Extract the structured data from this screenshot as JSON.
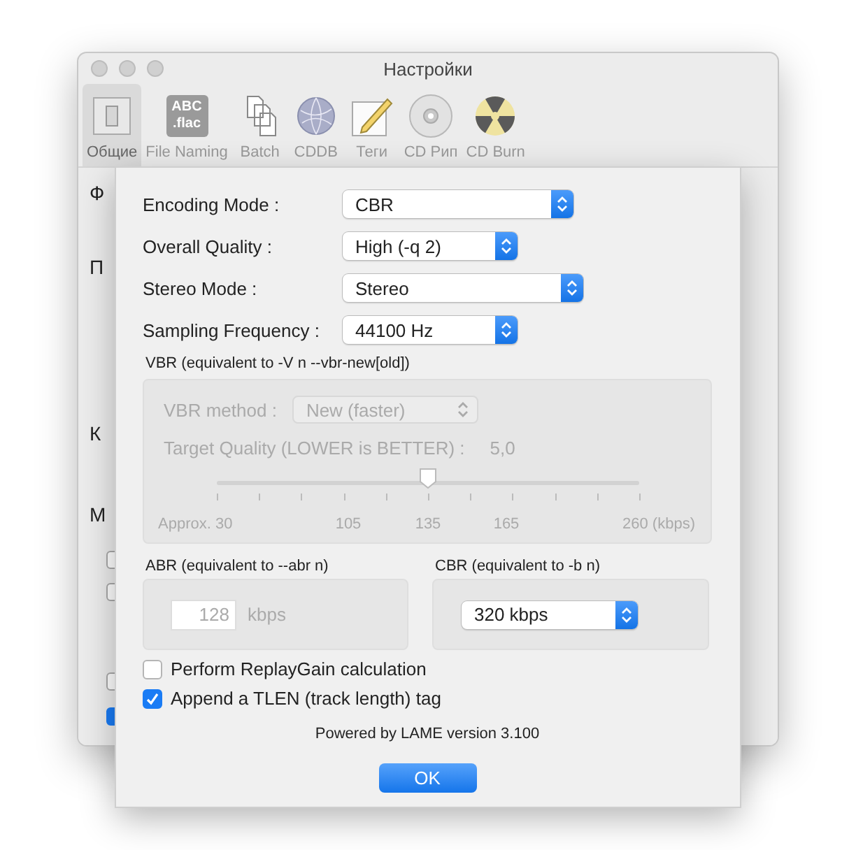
{
  "window": {
    "title": "Настройки"
  },
  "tabs": [
    {
      "label": "Общие",
      "kind": "general",
      "selected": true
    },
    {
      "label": "File Naming",
      "kind": "abc",
      "icon_text": [
        "ABC",
        ".flac"
      ],
      "selected": false
    },
    {
      "label": "Batch",
      "kind": "pages",
      "selected": false
    },
    {
      "label": "CDDB",
      "kind": "globe",
      "selected": false
    },
    {
      "label": "Теги",
      "kind": "note",
      "selected": false
    },
    {
      "label": "CD Рип",
      "kind": "disc",
      "selected": false
    },
    {
      "label": "CD Burn",
      "kind": "burn",
      "selected": false
    }
  ],
  "background_pane": {
    "labels": [
      "Ф",
      "П",
      "К",
      "М"
    ],
    "checkboxes": [
      {
        "checked": false
      },
      {
        "checked": false
      },
      {
        "checked": false
      },
      {
        "checked": true
      }
    ]
  },
  "sheet": {
    "settings": [
      {
        "label": "Encoding Mode :",
        "value": "CBR"
      },
      {
        "label": "Overall Quality :",
        "value": "High (-q 2)"
      },
      {
        "label": "Stereo Mode :",
        "value": "Stereo"
      },
      {
        "label": "Sampling Frequency :",
        "value": "44100 Hz"
      }
    ],
    "vbr": {
      "caption": "VBR (equivalent to -V n --vbr-new[old])",
      "disabled": true,
      "method_label": "VBR method :",
      "method_value": "New (faster)",
      "quality_label": "Target Quality (LOWER is BETTER) :",
      "quality_value": "5,0",
      "level": 0.5,
      "tick_labels": [
        "Approx. 30",
        "105",
        "135",
        "165",
        "260 (kbps)"
      ]
    },
    "abr": {
      "caption": "ABR (equivalent to --abr n)",
      "disabled": true,
      "value": "128",
      "unit": "kbps"
    },
    "cbr": {
      "caption": "CBR (equivalent to -b n)",
      "value": "320 kbps"
    },
    "options": [
      {
        "label": "Perform ReplayGain calculation",
        "checked": false
      },
      {
        "label": "Append a TLEN (track length) tag",
        "checked": true
      }
    ],
    "footer": "Powered by LAME version 3.100",
    "ok_button": "OK"
  }
}
